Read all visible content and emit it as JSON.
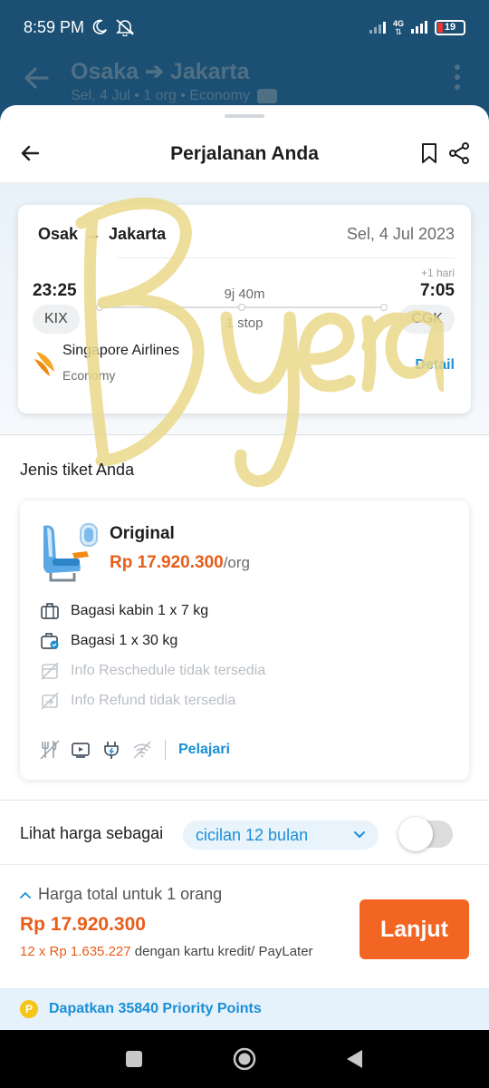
{
  "status_bar": {
    "time": "8:59 PM",
    "network": "4G",
    "battery": "19"
  },
  "background_header": {
    "origin": "Osaka",
    "destination": "Jakarta",
    "subtitle": "Sel, 4 Jul • 1 org • Economy"
  },
  "sheet": {
    "title": "Perjalanan Anda"
  },
  "flight": {
    "origin": "Osak",
    "destination": "Jakarta",
    "date": "Sel, 4 Jul 2023",
    "departure_time": "23:25",
    "arrival_note": "+1 hari",
    "arrival_time": "7:05",
    "duration": "9j 40m",
    "stops": "1 stop",
    "departure_code": "KIX",
    "arrival_code": "CGK",
    "airline": "Singapore Airlines",
    "cabin": "Economy",
    "detail_label": "Detail"
  },
  "watermark": {
    "text": "Byera"
  },
  "ticket": {
    "section_title": "Jenis tiket Anda",
    "name": "Original",
    "price": "Rp 17.920.300",
    "price_unit": "/org",
    "features": [
      {
        "label": "Bagasi kabin 1 x 7 kg",
        "available": true
      },
      {
        "label": "Bagasi 1 x 30 kg",
        "available": true
      },
      {
        "label": "Info Reschedule tidak tersedia",
        "available": false
      },
      {
        "label": "Info Refund tidak tersedia",
        "available": false
      }
    ],
    "amenities": [
      "meal-icon",
      "entertainment-icon",
      "power-icon",
      "wifi-icon"
    ],
    "learn_label": "Pelajari"
  },
  "price_view": {
    "label": "Lihat harga sebagai",
    "selected_option": "cicilan 12 bulan",
    "toggle_on": false
  },
  "total": {
    "label": "Harga total untuk 1 orang",
    "price": "Rp 17.920.300",
    "installment_amount": "12 x Rp 1.635.227",
    "installment_suffix": " dengan kartu kredit/ PayLater",
    "cta": "Lanjut"
  },
  "points": {
    "text": "Dapatkan 35840 Priority Points"
  },
  "colors": {
    "accent": "#1a8fd6",
    "price": "#e85d1a",
    "cta": "#f26522",
    "header_bg": "#1b4f73"
  }
}
